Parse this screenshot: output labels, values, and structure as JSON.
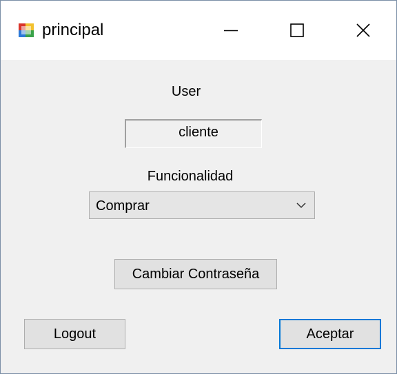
{
  "window": {
    "title": "principal",
    "app_icon": "winforms-app-icon",
    "controls": {
      "minimize_icon": "minimize-icon",
      "maximize_icon": "maximize-icon",
      "close_icon": "close-icon"
    }
  },
  "form": {
    "user_label": "User",
    "user_value": "cliente",
    "funcionalidad_label": "Funcionalidad",
    "funcionalidad_selected": "Comprar",
    "change_password_label": "Cambiar Contraseña",
    "logout_label": "Logout",
    "accept_label": "Aceptar"
  },
  "colors": {
    "window_bg": "#f0f0f0",
    "titlebar_bg": "#ffffff",
    "button_bg": "#e1e1e1",
    "combo_bg": "#e5e5e5",
    "default_button_border": "#0078d7"
  }
}
